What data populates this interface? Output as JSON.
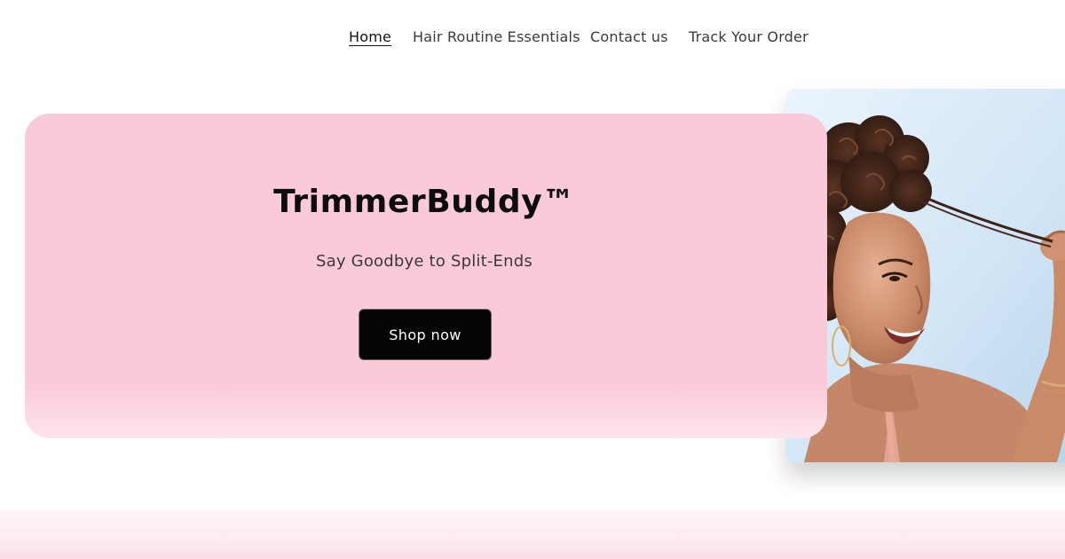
{
  "nav": {
    "items": [
      {
        "label": "Home",
        "active": true
      },
      {
        "label": "Hair Routine Essentials",
        "active": false
      },
      {
        "label": "Contact us",
        "active": false
      },
      {
        "label": "Track Your Order",
        "active": false
      }
    ]
  },
  "hero": {
    "title": "TrimmerBuddy™",
    "subtitle": "Say Goodbye to Split-Ends",
    "cta_label": "Shop now"
  },
  "colors": {
    "hero_background": "#fbcad9",
    "button_background": "#050505",
    "button_text": "#ffffff",
    "photo_sky": "#cfe4f6",
    "bottom_strip": "#fbdde8"
  }
}
